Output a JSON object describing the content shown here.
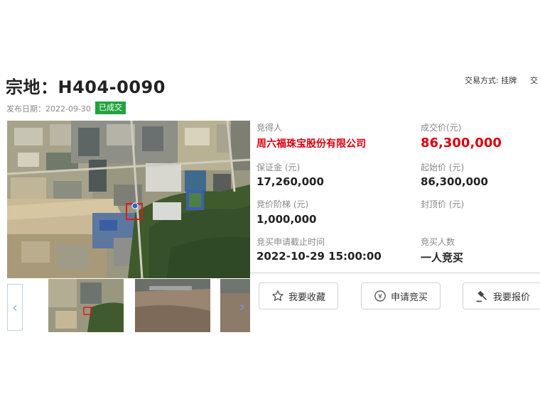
{
  "header": {
    "title": "宗地：H404-0090",
    "trade_mode": "交易方式: 挂牌",
    "trade_mode_cut": "交",
    "publish_date": "发布日期：2022-09-30",
    "status": "已成交"
  },
  "info": {
    "winner_label": "竞得人",
    "winner_value": "周六福珠宝股份有限公司",
    "deal_price_label": "成交价(元)",
    "deal_price_value": "86,300,000",
    "deposit_label": "保证金 (元)",
    "deposit_value": "17,260,000",
    "start_price_label": "起始价 (元)",
    "start_price_value": "86,300,000",
    "increment_label": "竞价阶梯 (元)",
    "increment_value": "1,000,000",
    "cap_price_label": "封顶价 (元)",
    "deadline_label": "竞买申请截止时间",
    "deadline_value": "2022-10-29 15:00:00",
    "bidders_label": "竞买人数",
    "bidders_value": "一人竞买"
  },
  "actions": {
    "favorite": "我要收藏",
    "apply": "申请竞买",
    "bid": "我要报价"
  },
  "colors": {
    "accent_red": "#d9000f",
    "status_green": "#21a33f"
  }
}
